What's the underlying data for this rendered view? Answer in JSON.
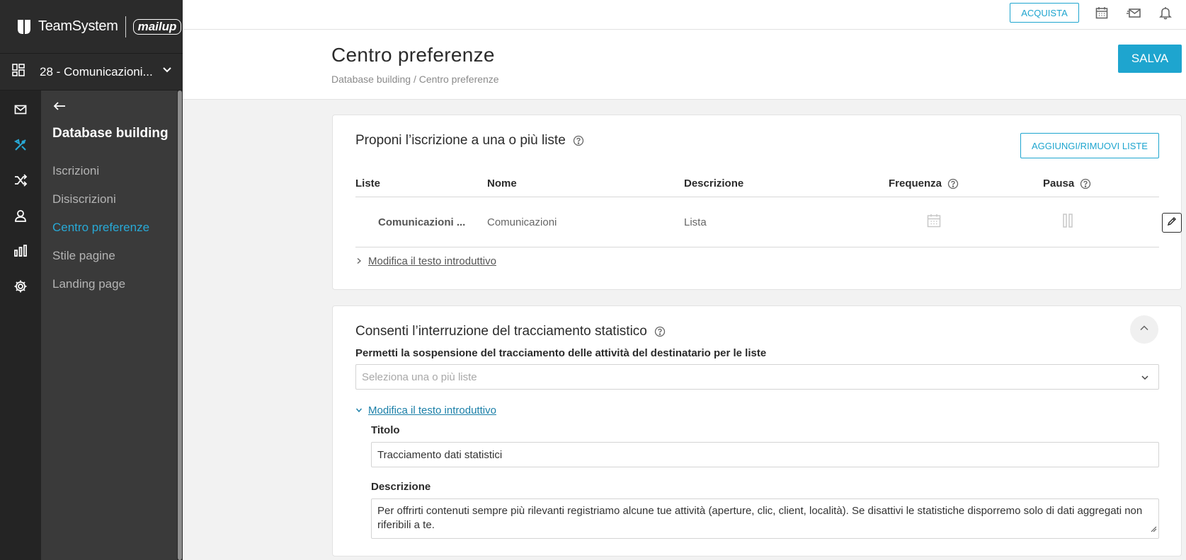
{
  "brand": {
    "name": "TeamSystem",
    "partner": "mailup"
  },
  "account": {
    "name": "28 - Comunicazioni..."
  },
  "rail": {
    "items": [
      {
        "icon": "email-icon"
      },
      {
        "icon": "tools-icon",
        "active": true
      },
      {
        "icon": "shuffle-icon"
      },
      {
        "icon": "user-icon"
      },
      {
        "icon": "bar-chart-icon"
      },
      {
        "icon": "gear-icon"
      }
    ]
  },
  "subnav": {
    "title": "Database building",
    "items": [
      {
        "label": "Iscrizioni"
      },
      {
        "label": "Disiscrizioni"
      },
      {
        "label": "Centro preferenze",
        "active": true
      },
      {
        "label": "Stile pagine"
      },
      {
        "label": "Landing page"
      }
    ]
  },
  "topbar": {
    "buy_label": "ACQUISTA"
  },
  "header": {
    "title": "Centro preferenze",
    "breadcrumb": "Database building / Centro preferenze",
    "save_label": "SALVA"
  },
  "lists_card": {
    "title": "Proponi l’iscrizione a una o più liste",
    "manage_label": "AGGIUNGI/RIMUOVI LISTE",
    "columns": [
      "Liste",
      "Nome",
      "Descrizione",
      "Frequenza",
      "Pausa"
    ],
    "rows": [
      {
        "list": "Comunicazioni ...",
        "name": "Comunicazioni",
        "description": "Lista"
      }
    ],
    "intro_link": "Modifica il testo introduttivo"
  },
  "tracking_card": {
    "title": "Consenti l’interruzione del tracciamento statistico",
    "select_label": "Permetti la sospensione del tracciamento delle attività del destinatario per le liste",
    "select_placeholder": "Seleziona una o più liste",
    "intro_link": "Modifica il testo introduttivo",
    "title_label": "Titolo",
    "title_value": "Tracciamento dati statistici",
    "desc_label": "Descrizione",
    "desc_value": "Per offrirti contenuti sempre più rilevanti registriamo alcune tue attività (aperture, clic, client, località). Se disattivi le statistiche disporremo solo di dati aggregati non riferibili a te."
  },
  "colors": {
    "accent": "#1ea5cf",
    "sidebar": "#2b2b2b",
    "subnav": "#3a3a3a",
    "active_nav": "#28a9d6"
  }
}
